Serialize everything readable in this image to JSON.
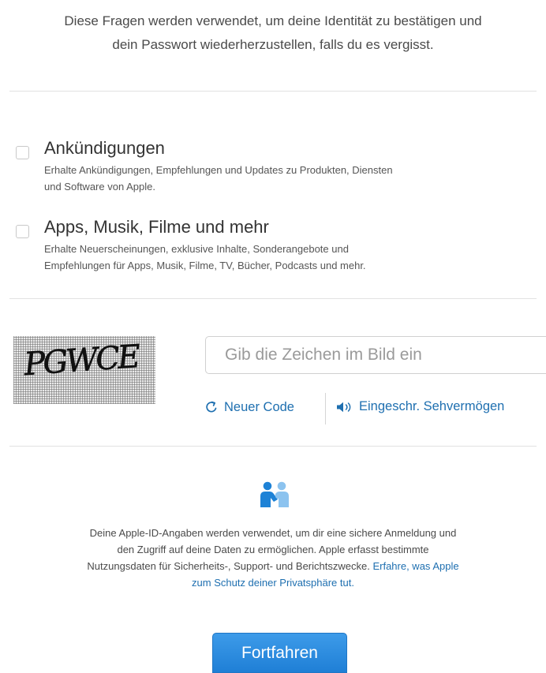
{
  "intro": {
    "line1": "Diese Fragen werden verwendet, um deine Identität zu bestätigen und",
    "line2": "dein Passwort wiederherzustellen, falls du es vergisst."
  },
  "options": [
    {
      "title": "Ankündigungen",
      "desc_line1": "Erhalte Ankündigungen, Empfehlungen und Updates zu Produkten, Diensten",
      "desc_line2": "und Software von Apple.",
      "checked": false
    },
    {
      "title": "Apps, Musik, Filme und mehr",
      "desc_line1": "Erhalte Neuerscheinungen, exklusive Inhalte, Sonderangebote und",
      "desc_line2": "Empfehlungen für Apps, Musik, Filme, TV, Bücher, Podcasts und mehr.",
      "checked": false
    }
  ],
  "captcha": {
    "image_text": "PGWCE",
    "input_value": "",
    "input_placeholder": "Gib die Zeichen im Bild ein",
    "new_code_label": "Neuer Code",
    "new_code_icon": "refresh-icon",
    "audio_label": "Eingeschr. Sehvermögen",
    "audio_icon": "speaker-icon"
  },
  "privacy": {
    "icon": "handshake-people-icon",
    "line1": "Deine Apple-ID-Angaben werden verwendet, um dir eine sichere Anmeldung und",
    "line2": "den Zugriff auf deine Daten zu ermöglichen. Apple erfasst bestimmte",
    "line3_text": "Nutzungsdaten für Sicherheits-, Support- und Berichtszwecke.",
    "link_part1": "Erfahre, was Apple",
    "link_part2": "zum Schutz deiner Privatsphäre tut."
  },
  "continue_label": "Fortfahren",
  "colors": {
    "link": "#1e6fb0",
    "button": "#2a88dd",
    "icon_blue": "#1e82d6",
    "icon_light": "#8cc3ef"
  }
}
